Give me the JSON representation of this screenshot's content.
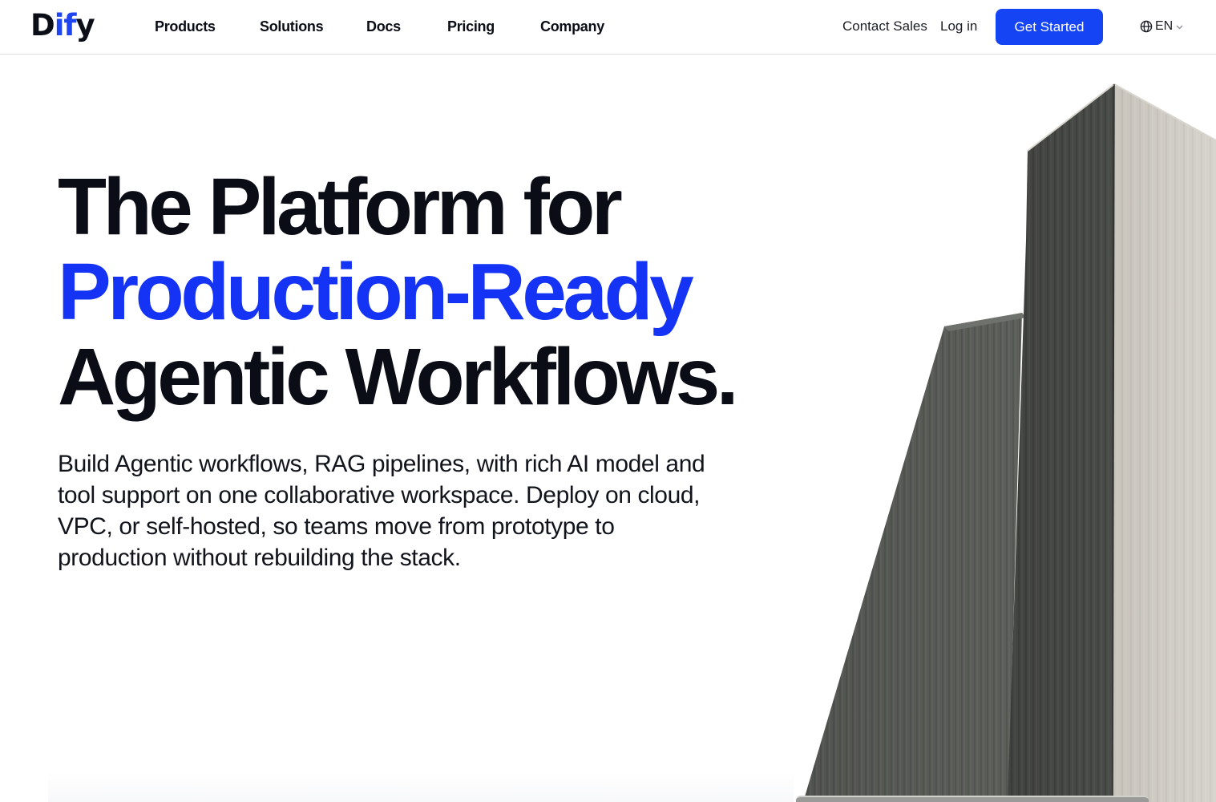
{
  "header": {
    "logo": {
      "prefix": "D",
      "accent": "if",
      "suffix": "y"
    },
    "nav": [
      {
        "label": "Products"
      },
      {
        "label": "Solutions"
      },
      {
        "label": "Docs"
      },
      {
        "label": "Pricing"
      },
      {
        "label": "Company"
      }
    ],
    "contact_sales": "Contact Sales",
    "login": "Log in",
    "get_started": "Get Started",
    "language": "EN",
    "icons": {
      "language": "globe-icon",
      "dropdown": "chevron-down-icon"
    }
  },
  "hero": {
    "headline_line1": "The Platform for",
    "headline_line2": "Production-Ready",
    "headline_line3": "Agentic Workflows.",
    "subtext": "Build Agentic workflows, RAG pipelines, with rich AI model and tool support on one collaborative workspace. Deploy on cloud, VPC, or self-hosted, so teams move from prototype to production without rebuilding the stack."
  },
  "colors": {
    "accent": "#1433f5",
    "button": "#1544f5",
    "text": "#0a0c16"
  }
}
